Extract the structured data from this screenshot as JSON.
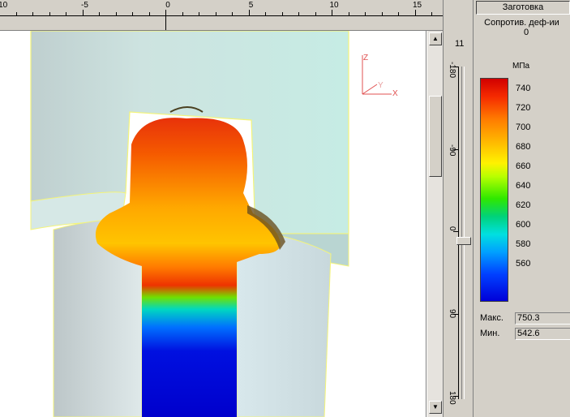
{
  "top_ruler": {
    "labels": [
      {
        "text": "-10",
        "pos": -10
      },
      {
        "text": "-5",
        "pos": -5
      },
      {
        "text": "0",
        "pos": 0
      },
      {
        "text": "5",
        "pos": 5
      },
      {
        "text": "10",
        "pos": 10
      },
      {
        "text": "15",
        "pos": 15
      }
    ]
  },
  "side_ruler": {
    "count": "11",
    "labels": [
      "-180",
      "-90",
      "0",
      "90",
      "180"
    ]
  },
  "axes": {
    "x": "X",
    "y": "Y",
    "z": "Z"
  },
  "panel": {
    "object_tab": "Заготовка",
    "field_name": "Сопротив. деф-ии",
    "step": "0",
    "unit": "МПа",
    "scale_labels": [
      "740",
      "720",
      "700",
      "680",
      "660",
      "640",
      "620",
      "600",
      "580",
      "560"
    ],
    "max_label": "Макс.",
    "max_value": "750.3",
    "min_label": "Мин.",
    "min_value": "542.6"
  },
  "colors": {
    "die_fill": "#c8e6e0",
    "die_edge": "#ffff66",
    "workpiece_hot": "#e83a00",
    "workpiece_cold": "#0000d0"
  }
}
